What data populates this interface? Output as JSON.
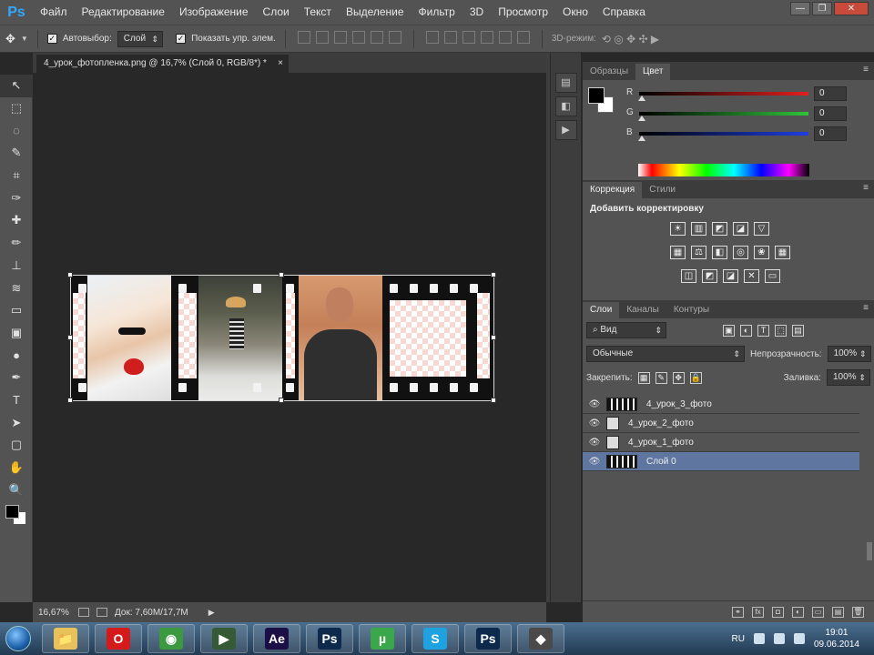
{
  "app": {
    "logo": "Ps"
  },
  "menu": [
    "Файл",
    "Редактирование",
    "Изображение",
    "Слои",
    "Текст",
    "Выделение",
    "Фильтр",
    "3D",
    "Просмотр",
    "Окно",
    "Справка"
  ],
  "window_controls": {
    "minimize": "—",
    "restore": "❐",
    "close": "✕"
  },
  "options": {
    "move_tool_icon": "move-icon",
    "autoselect_label": "Автовыбор:",
    "autoselect_value": "Слой",
    "show_controls_label": "Показать упр. элем.",
    "mode_3d_label": "3D-режим:"
  },
  "document": {
    "tab_title": "4_урок_фотопленка.png @ 16,7% (Слой 0, RGB/8*) *",
    "close": "×"
  },
  "tools": [
    "↖",
    "⬚",
    "◌",
    "✎",
    "⌗",
    "✑",
    "✚",
    "✏",
    "⊥",
    "≋",
    "▭",
    "▣",
    "●",
    "✒",
    "T",
    "➤",
    "▢",
    "✋",
    "🔍"
  ],
  "status": {
    "zoom": "16,67%",
    "doc": "Док: 7,60M/17,7M",
    "arrow": "▶"
  },
  "color_panel": {
    "tabs": [
      "Образцы",
      "Цвет"
    ],
    "sliders": [
      {
        "label": "R",
        "value": "0",
        "color": "#e21f1f"
      },
      {
        "label": "G",
        "value": "0",
        "color": "#2ec43a"
      },
      {
        "label": "B",
        "value": "0",
        "color": "#1f3ee2"
      }
    ]
  },
  "adjustments_panel": {
    "tabs": [
      "Коррекция",
      "Стили"
    ],
    "title": "Добавить корректировку",
    "row1": [
      "☀",
      "▥",
      "◩",
      "◪",
      "▽"
    ],
    "row2": [
      "▦",
      "⚖",
      "◧",
      "◎",
      "❀",
      "▦"
    ],
    "row3": [
      "◫",
      "◩",
      "◪",
      "✕",
      "▭"
    ]
  },
  "layers_panel": {
    "tabs": [
      "Слои",
      "Каналы",
      "Контуры"
    ],
    "filter_label": "Вид",
    "blend_mode": "Обычные",
    "opacity_label": "Непрозрачность:",
    "opacity_value": "100%",
    "lock_label": "Закрепить:",
    "fill_label": "Заливка:",
    "fill_value": "100%",
    "layers": [
      {
        "name": "4_урок_3_фото",
        "thumb": "film",
        "selected": false
      },
      {
        "name": "4_урок_2_фото",
        "thumb": "smart",
        "selected": false
      },
      {
        "name": "4_урок_1_фото",
        "thumb": "smart",
        "selected": false
      },
      {
        "name": "Слой 0",
        "thumb": "film",
        "selected": true
      }
    ],
    "footer_icons": [
      "⚭",
      "fx",
      "◘",
      "◐",
      "▭",
      "▤",
      "🗑"
    ]
  },
  "taskbar": {
    "apps": [
      {
        "name": "explorer",
        "glyph": "📁",
        "bg": "#e8c15a"
      },
      {
        "name": "opera",
        "glyph": "O",
        "bg": "#d41a1a"
      },
      {
        "name": "chrome",
        "glyph": "◉",
        "bg": "#3b9a3f"
      },
      {
        "name": "console",
        "glyph": "▶",
        "bg": "#355a35"
      },
      {
        "name": "after-effects",
        "glyph": "Ae",
        "bg": "#1b0f45"
      },
      {
        "name": "photoshop",
        "glyph": "Ps",
        "bg": "#0d2a4d"
      },
      {
        "name": "utorrent",
        "glyph": "µ",
        "bg": "#3aa84a"
      },
      {
        "name": "skype",
        "glyph": "S",
        "bg": "#1fa3e0"
      },
      {
        "name": "photoshop-2",
        "glyph": "Ps",
        "bg": "#0d2a4d"
      },
      {
        "name": "tool",
        "glyph": "◆",
        "bg": "#4a4a4a"
      }
    ],
    "lang": "RU",
    "time": "19:01",
    "date": "09.06.2014"
  }
}
